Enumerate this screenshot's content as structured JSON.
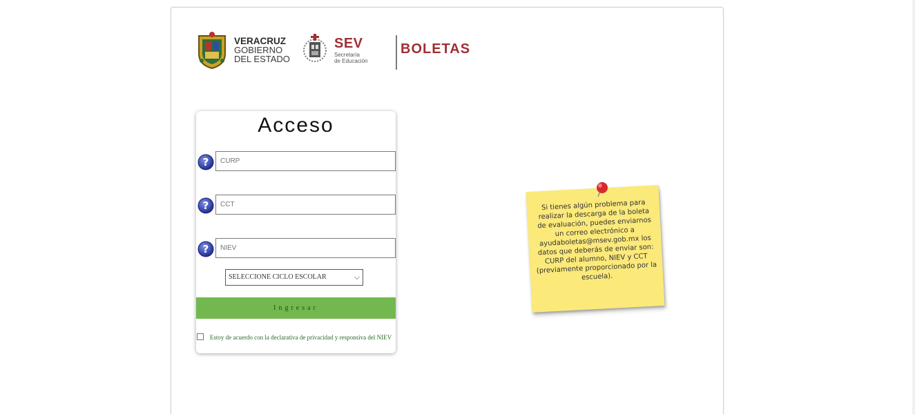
{
  "header": {
    "veracruz": {
      "line1": "VERACRUZ",
      "line2": "GOBIERNO",
      "line3": "DEL ESTADO"
    },
    "sev": {
      "name": "SEV",
      "line1": "Secretaría",
      "line2": "de Educación"
    },
    "app_name": "BOLETAS"
  },
  "login": {
    "title": "Acceso",
    "fields": [
      {
        "placeholder": "CURP"
      },
      {
        "placeholder": "CCT"
      },
      {
        "placeholder": "NIEV"
      }
    ],
    "select_value": "SELECCIONE CICLO ESCOLAR",
    "submit_label": "Ingresar",
    "agree_text": "Estoy de acuerdo con la declarativa de privacidad y responsiva del NIEV"
  },
  "note": {
    "text": "Si tienes algún problema para realizar la descarga de la boleta de evaluación, puedes enviarnos un correo electrónico a ayudaboletas@msev.gob.mx los datos que deberás de enviar son: CURP del alumno, NIEV y CCT (previamente proporcionado por la escuela)."
  },
  "colors": {
    "brand": "#9e2f33",
    "button": "#72b84f",
    "note": "#fbe97a",
    "help_icon": "#2b3aa6"
  },
  "icons": {
    "help": "question-circle-icon",
    "pin": "pushpin-icon"
  }
}
